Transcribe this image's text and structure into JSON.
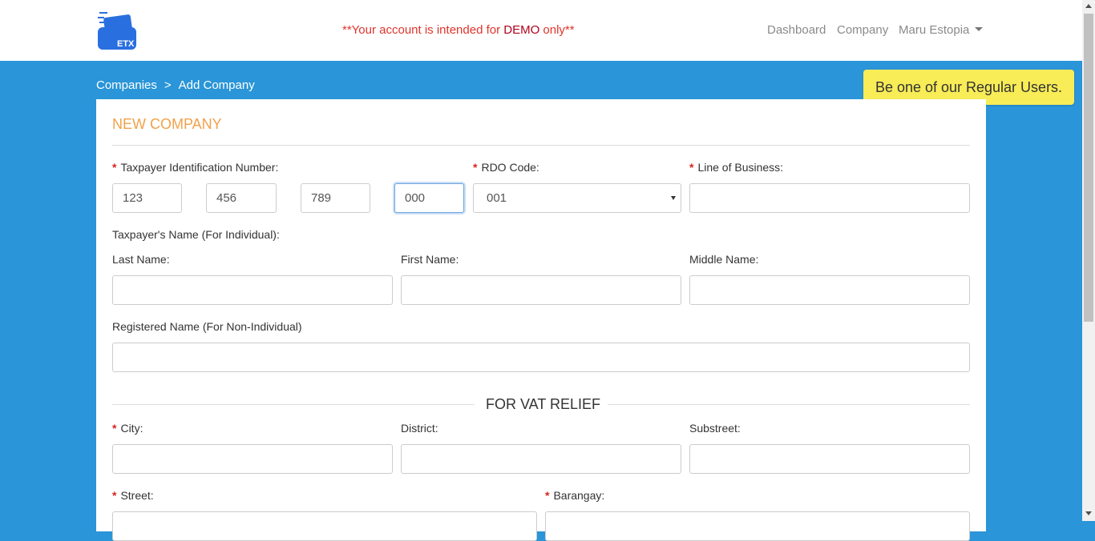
{
  "header": {
    "logo_alt": "ETX",
    "demo_prefix": "**Your account is intended for ",
    "demo_emphasis": "DEMO",
    "demo_suffix": " only**",
    "nav": {
      "dashboard": "Dashboard",
      "company": "Company",
      "user": "Maru Estopia"
    }
  },
  "breadcrumb": {
    "companies": "Companies",
    "separator": ">",
    "current": "Add Company"
  },
  "promo": {
    "text": "Be one of our Regular Users."
  },
  "form": {
    "title": "NEW COMPANY",
    "tin_label": "Taxpayer Identification Number:",
    "tin": [
      "123",
      "456",
      "789",
      "000"
    ],
    "rdo_label": "RDO Code:",
    "rdo_value": "001",
    "lob_label": "Line of Business:",
    "lob_value": "",
    "taxpayer_name_label": "Taxpayer's Name (For Individual):",
    "last_name_label": "Last Name:",
    "first_name_label": "First Name:",
    "middle_name_label": "Middle Name:",
    "registered_name_label": "Registered Name (For Non-Individual)",
    "vat_section": "FOR VAT RELIEF",
    "city_label": "City:",
    "district_label": "District:",
    "substreet_label": "Substreet:",
    "street_label": "Street:",
    "barangay_label": "Barangay:"
  },
  "colors": {
    "background": "#2a95d8",
    "accent_orange": "#f2a14b",
    "required_red": "#d9231d",
    "promo_yellow": "#f8ec57",
    "demo_red": "#e0342b"
  }
}
